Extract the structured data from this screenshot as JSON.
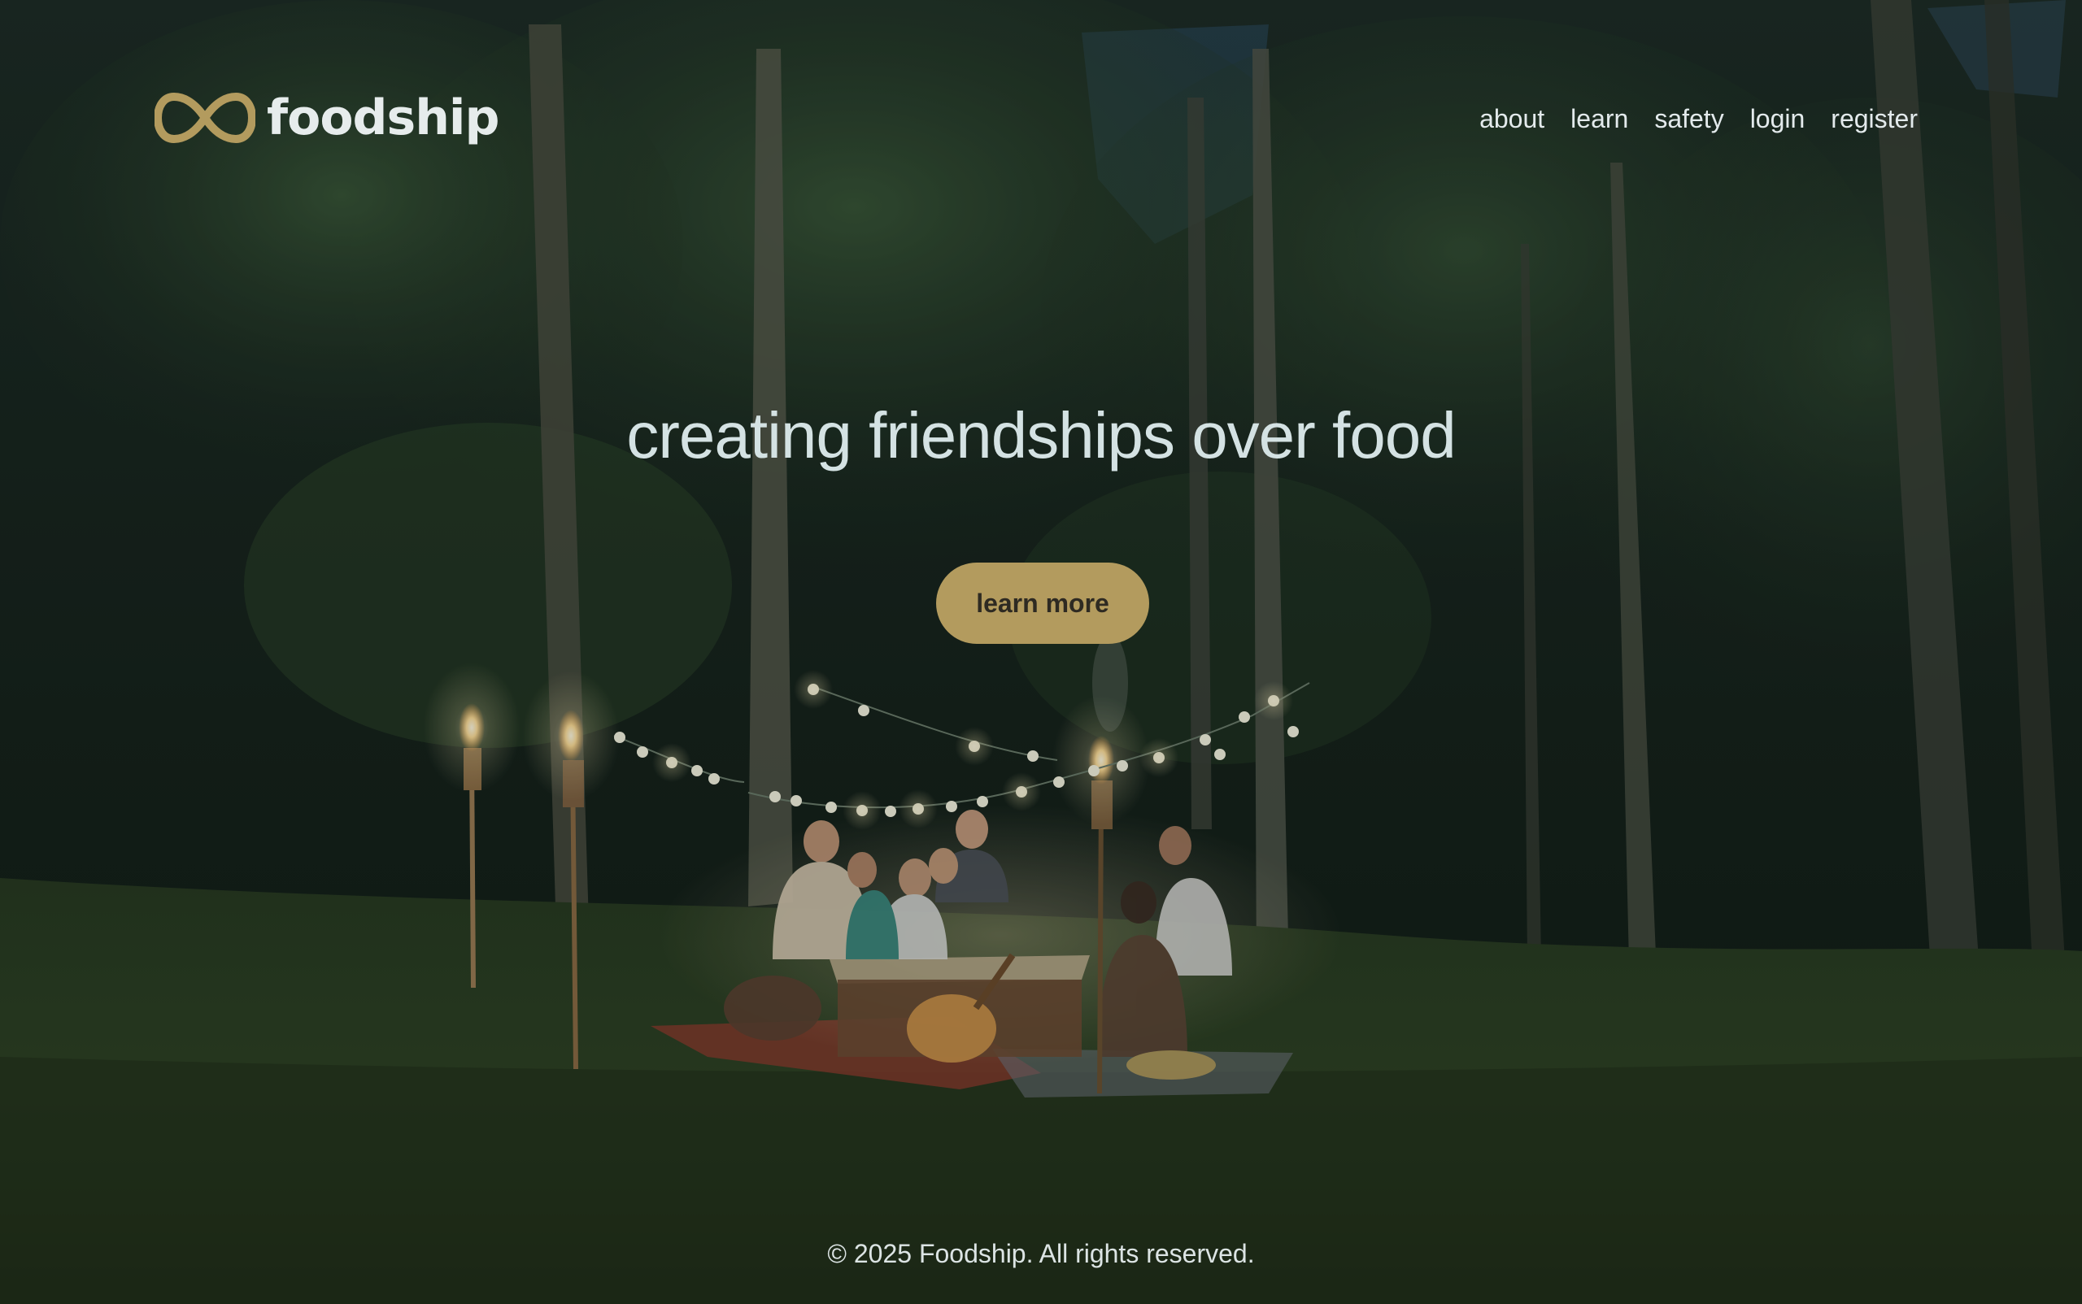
{
  "brand": {
    "name": "foodship",
    "logo_icon": "infinity-icon",
    "accent_color": "#b39b5e",
    "text_color": "#e6ecec"
  },
  "nav": {
    "items": [
      {
        "label": "about"
      },
      {
        "label": "learn"
      },
      {
        "label": "safety"
      },
      {
        "label": "login"
      },
      {
        "label": "register"
      }
    ]
  },
  "hero": {
    "headline": "creating friendships over food",
    "cta_label": "learn more",
    "background": "night-forest-dinner-photo"
  },
  "footer": {
    "copyright": "© 2025 Foodship. All rights reserved."
  }
}
